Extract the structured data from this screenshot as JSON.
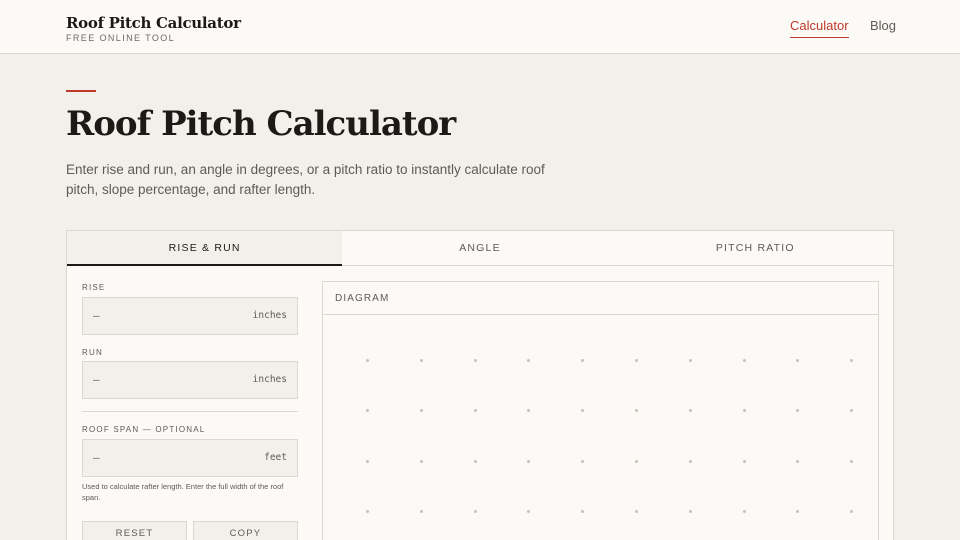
{
  "header": {
    "brand_title": "Roof Pitch Calculator",
    "brand_sub": "FREE ONLINE TOOL",
    "nav": [
      {
        "label": "Calculator",
        "active": true
      },
      {
        "label": "Blog",
        "active": false
      }
    ]
  },
  "hero": {
    "title": "Roof Pitch Calculator",
    "description": "Enter rise and run, an angle in degrees, or a pitch ratio to instantly calculate roof pitch, slope percentage, and rafter length."
  },
  "tabs": [
    {
      "label": "RISE & RUN",
      "active": true
    },
    {
      "label": "ANGLE",
      "active": false
    },
    {
      "label": "PITCH RATIO",
      "active": false
    }
  ],
  "form": {
    "rise": {
      "label": "RISE",
      "value": "—",
      "unit": "inches"
    },
    "run": {
      "label": "RUN",
      "value": "—",
      "unit": "inches"
    },
    "span": {
      "label": "ROOF SPAN — OPTIONAL",
      "value": "—",
      "unit": "feet"
    },
    "hint": "Used to calculate rafter length. Enter the full width of the roof span.",
    "reset_label": "RESET",
    "copy_label": "COPY"
  },
  "diagram": {
    "label": "DIAGRAM"
  },
  "colors": {
    "accent": "#c0392b",
    "background": "#f2f0ea",
    "surface": "#fbfaf7",
    "border": "#dcd8cf"
  }
}
